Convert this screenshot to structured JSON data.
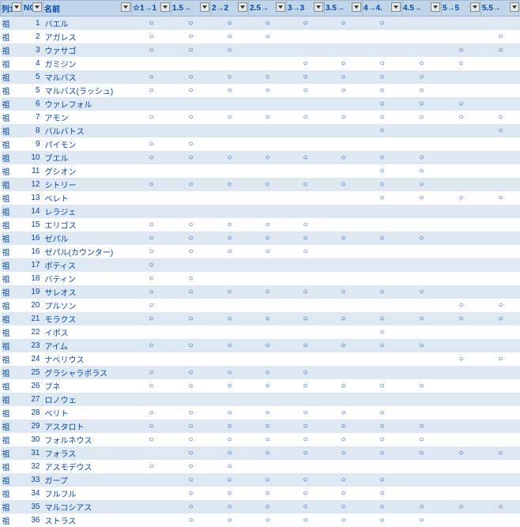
{
  "headers": [
    "列1",
    "NO",
    "名前",
    "☆1→1",
    "1.5→",
    "2→2",
    "2.5→",
    "3→3",
    "3.5→",
    "4→4.",
    "4.5→",
    "5→5",
    "5.5→"
  ],
  "mark": "○",
  "rows": [
    {
      "c": "祖",
      "n": 1,
      "name": "バエル",
      "m": [
        1,
        1,
        1,
        1,
        1,
        1,
        1,
        0,
        0,
        0
      ]
    },
    {
      "c": "祖",
      "n": 2,
      "name": "アガレス",
      "m": [
        1,
        1,
        1,
        1,
        0,
        0,
        0,
        0,
        0,
        1
      ]
    },
    {
      "c": "祖",
      "n": 3,
      "name": "ウァサゴ",
      "m": [
        1,
        1,
        1,
        0,
        0,
        0,
        0,
        0,
        1,
        1
      ]
    },
    {
      "c": "祖",
      "n": 4,
      "name": "ガミジン",
      "m": [
        0,
        0,
        0,
        0,
        1,
        1,
        1,
        1,
        1,
        0
      ]
    },
    {
      "c": "祖",
      "n": 5,
      "name": "マルバス",
      "m": [
        1,
        1,
        1,
        1,
        1,
        1,
        1,
        1,
        0,
        0
      ]
    },
    {
      "c": "祖",
      "n": 5,
      "name": "マルバス(ラッシュ)",
      "m": [
        1,
        1,
        1,
        1,
        1,
        1,
        1,
        1,
        0,
        0
      ]
    },
    {
      "c": "祖",
      "n": 6,
      "name": "ウァレフォル",
      "m": [
        0,
        0,
        0,
        0,
        0,
        0,
        1,
        1,
        1,
        0
      ]
    },
    {
      "c": "祖",
      "n": 7,
      "name": "アモン",
      "m": [
        1,
        1,
        1,
        1,
        1,
        1,
        1,
        1,
        1,
        1
      ]
    },
    {
      "c": "祖",
      "n": 8,
      "name": "バルバトス",
      "m": [
        0,
        0,
        0,
        0,
        0,
        0,
        1,
        0,
        0,
        1
      ]
    },
    {
      "c": "祖",
      "n": 9,
      "name": "パイモン",
      "m": [
        1,
        1,
        0,
        0,
        0,
        0,
        0,
        0,
        0,
        0
      ]
    },
    {
      "c": "祖",
      "n": 10,
      "name": "ブエル",
      "m": [
        1,
        1,
        1,
        1,
        1,
        1,
        1,
        1,
        0,
        0
      ]
    },
    {
      "c": "祖",
      "n": 11,
      "name": "グシオン",
      "m": [
        0,
        0,
        0,
        0,
        0,
        0,
        1,
        1,
        0,
        0
      ]
    },
    {
      "c": "祖",
      "n": 12,
      "name": "シトリー",
      "m": [
        1,
        1,
        1,
        1,
        1,
        1,
        1,
        1,
        0,
        0
      ]
    },
    {
      "c": "祖",
      "n": 13,
      "name": "ベレト",
      "m": [
        0,
        0,
        0,
        0,
        0,
        0,
        1,
        1,
        1,
        1
      ]
    },
    {
      "c": "祖",
      "n": 14,
      "name": "レラジェ",
      "m": [
        0,
        0,
        0,
        0,
        0,
        0,
        0,
        0,
        0,
        0
      ]
    },
    {
      "c": "祖",
      "n": 15,
      "name": "エリゴス",
      "m": [
        1,
        1,
        1,
        1,
        1,
        0,
        0,
        0,
        0,
        0
      ]
    },
    {
      "c": "祖",
      "n": 16,
      "name": "ゼパル",
      "m": [
        1,
        1,
        1,
        1,
        1,
        1,
        1,
        1,
        0,
        0
      ]
    },
    {
      "c": "祖",
      "n": 16,
      "name": "ゼパル(カウンター)",
      "m": [
        1,
        1,
        1,
        1,
        1,
        0,
        0,
        0,
        0,
        0
      ]
    },
    {
      "c": "祖",
      "n": 17,
      "name": "ボティス",
      "m": [
        1,
        0,
        0,
        0,
        0,
        0,
        0,
        0,
        0,
        0
      ]
    },
    {
      "c": "祖",
      "n": 18,
      "name": "バティン",
      "m": [
        1,
        1,
        0,
        0,
        0,
        0,
        0,
        0,
        0,
        0
      ]
    },
    {
      "c": "祖",
      "n": 19,
      "name": "サレオス",
      "m": [
        1,
        1,
        1,
        1,
        1,
        1,
        1,
        1,
        0,
        0
      ]
    },
    {
      "c": "祖",
      "n": 20,
      "name": "プルソン",
      "m": [
        1,
        0,
        0,
        0,
        0,
        0,
        0,
        0,
        1,
        1
      ]
    },
    {
      "c": "祖",
      "n": 21,
      "name": "モラクス",
      "m": [
        1,
        1,
        1,
        1,
        1,
        1,
        1,
        1,
        1,
        1
      ]
    },
    {
      "c": "祖",
      "n": 22,
      "name": "イポス",
      "m": [
        0,
        0,
        0,
        0,
        0,
        0,
        1,
        0,
        0,
        0
      ]
    },
    {
      "c": "祖",
      "n": 23,
      "name": "アイム",
      "m": [
        1,
        1,
        1,
        1,
        1,
        1,
        1,
        1,
        0,
        0
      ]
    },
    {
      "c": "祖",
      "n": 24,
      "name": "ナベリウス",
      "m": [
        0,
        0,
        0,
        0,
        0,
        0,
        0,
        0,
        1,
        1
      ]
    },
    {
      "c": "祖",
      "n": 25,
      "name": "グラシャラボラス",
      "m": [
        1,
        1,
        1,
        1,
        1,
        0,
        0,
        0,
        0,
        0
      ]
    },
    {
      "c": "祖",
      "n": 26,
      "name": "ブネ",
      "m": [
        1,
        1,
        1,
        1,
        1,
        1,
        1,
        1,
        0,
        0
      ]
    },
    {
      "c": "祖",
      "n": 27,
      "name": "ロノウェ",
      "m": [
        0,
        0,
        0,
        0,
        0,
        0,
        0,
        0,
        0,
        0
      ]
    },
    {
      "c": "祖",
      "n": 28,
      "name": "ベリト",
      "m": [
        1,
        1,
        1,
        1,
        1,
        1,
        1,
        0,
        0,
        0
      ]
    },
    {
      "c": "祖",
      "n": 29,
      "name": "アスタロト",
      "m": [
        1,
        1,
        1,
        1,
        1,
        1,
        1,
        1,
        0,
        0
      ]
    },
    {
      "c": "祖",
      "n": 30,
      "name": "フォルネウス",
      "m": [
        1,
        1,
        1,
        1,
        1,
        1,
        1,
        1,
        0,
        0
      ]
    },
    {
      "c": "祖",
      "n": 31,
      "name": "フォラス",
      "m": [
        0,
        1,
        1,
        1,
        1,
        1,
        1,
        1,
        1,
        1
      ]
    },
    {
      "c": "祖",
      "n": 32,
      "name": "アスモデウス",
      "m": [
        1,
        1,
        1,
        0,
        0,
        0,
        0,
        0,
        0,
        0
      ]
    },
    {
      "c": "祖",
      "n": 33,
      "name": "ガープ",
      "m": [
        0,
        1,
        1,
        1,
        1,
        1,
        1,
        0,
        0,
        0
      ]
    },
    {
      "c": "祖",
      "n": 34,
      "name": "フルフル",
      "m": [
        0,
        1,
        1,
        1,
        1,
        1,
        1,
        0,
        0,
        0
      ]
    },
    {
      "c": "祖",
      "n": 35,
      "name": "マルコシアス",
      "m": [
        0,
        1,
        1,
        1,
        1,
        1,
        1,
        1,
        1,
        1
      ]
    },
    {
      "c": "祖",
      "n": 36,
      "name": "ストラス",
      "m": [
        0,
        1,
        1,
        1,
        1,
        1,
        1,
        1,
        0,
        0
      ]
    }
  ]
}
